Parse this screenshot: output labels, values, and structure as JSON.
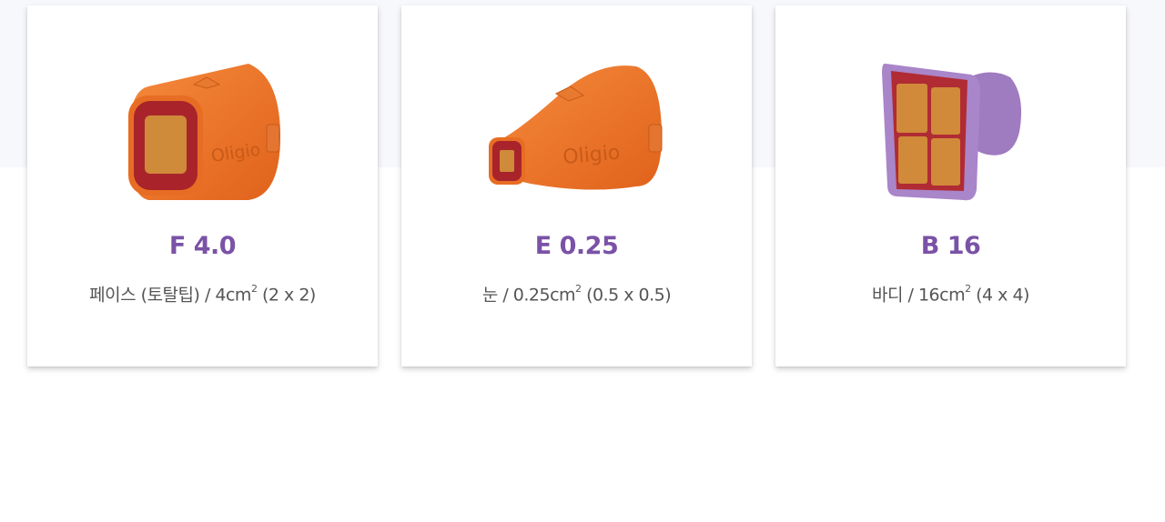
{
  "cards": [
    {
      "title": "F 4.0",
      "desc_main": "페이스 (토탈팁) / 4cm",
      "desc_sup": "2",
      "desc_tail": " (2 x 2)",
      "image_icon": "tip-f40-orange-icon",
      "logo_text": "Oligio"
    },
    {
      "title": "E 0.25",
      "desc_main": "눈 / 0.25cm",
      "desc_sup": "2",
      "desc_tail": " (0.5 x 0.5)",
      "image_icon": "tip-e025-orange-icon",
      "logo_text": "Oligio"
    },
    {
      "title": "B 16",
      "desc_main": "바디 / 16cm",
      "desc_sup": "2",
      "desc_tail": " (4 x 4)",
      "image_icon": "tip-b16-purple-icon"
    }
  ],
  "colors": {
    "title": "#7a52a6",
    "orange": "#f0782a",
    "purple": "#a07cc0",
    "tip_red": "#b32b2e"
  }
}
